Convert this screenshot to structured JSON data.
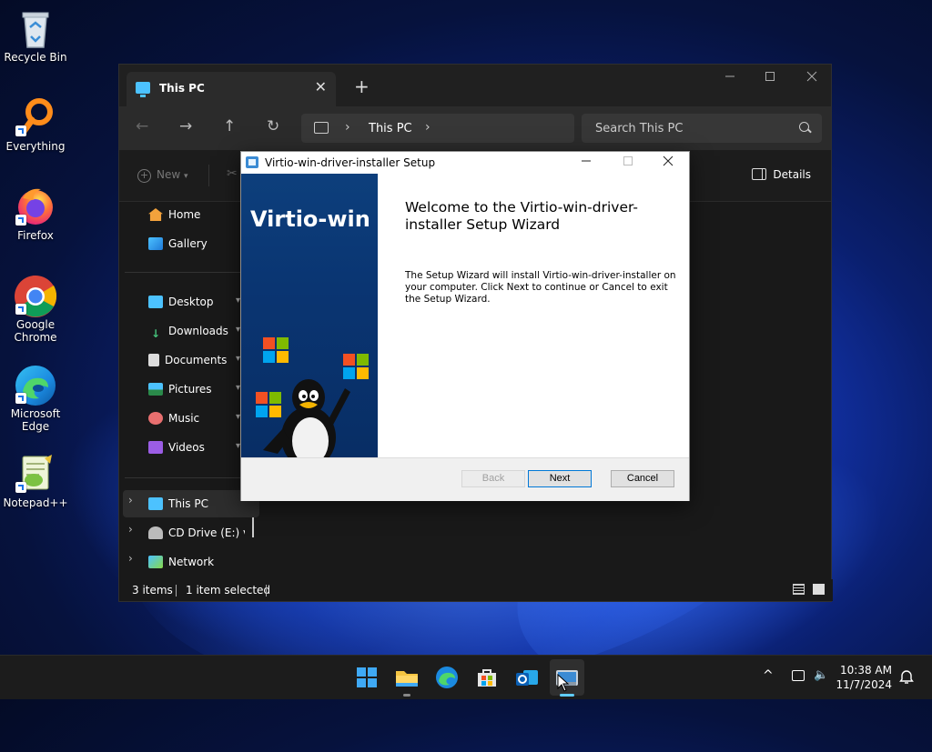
{
  "desktop": {
    "icons": [
      {
        "label": "Recycle Bin"
      },
      {
        "label": "Everything"
      },
      {
        "label": "Firefox"
      },
      {
        "label": "Google Chrome"
      },
      {
        "label": "Microsoft Edge"
      },
      {
        "label": "Notepad++"
      }
    ]
  },
  "explorer": {
    "tab_label": "This PC",
    "tab_close": "✕",
    "new_tab": "+",
    "nav": {
      "back": "←",
      "forward": "→",
      "up": "↑",
      "refresh": "↻"
    },
    "address": {
      "separator": "›",
      "location": "This PC"
    },
    "search_placeholder": "Search This PC",
    "toolbar": {
      "new_label": "New",
      "new_arrow": "▾",
      "details_label": "Details"
    },
    "sidebar": {
      "quick": [
        {
          "label": "Home"
        },
        {
          "label": "Gallery"
        }
      ],
      "pinned": [
        {
          "label": "Desktop"
        },
        {
          "label": "Downloads"
        },
        {
          "label": "Documents"
        },
        {
          "label": "Pictures"
        },
        {
          "label": "Music"
        },
        {
          "label": "Videos"
        }
      ],
      "tree": [
        {
          "label": "This PC"
        },
        {
          "label": "CD Drive (E:) virt"
        },
        {
          "label": "Network"
        }
      ],
      "pin_glyph": "📌",
      "tree_chevron": "›"
    },
    "status": {
      "items": "3 items",
      "selected": "1 item selected"
    }
  },
  "setup": {
    "title": "Virtio-win-driver-installer Setup",
    "banner_title": "Virtio-win",
    "welcome": "Welcome to the Virtio-win-driver-installer Setup Wizard",
    "description": "The Setup Wizard will install Virtio-win-driver-installer on your computer. Click Next to continue or Cancel to exit the Setup Wizard.",
    "buttons": {
      "back": "Back",
      "next": "Next",
      "cancel": "Cancel"
    }
  },
  "taskbar": {
    "time": "10:38 AM",
    "date": "11/7/2024",
    "tray_chevron": "^"
  },
  "colors": {
    "accent": "#0078d7",
    "active_indicator": "#60cdff"
  }
}
